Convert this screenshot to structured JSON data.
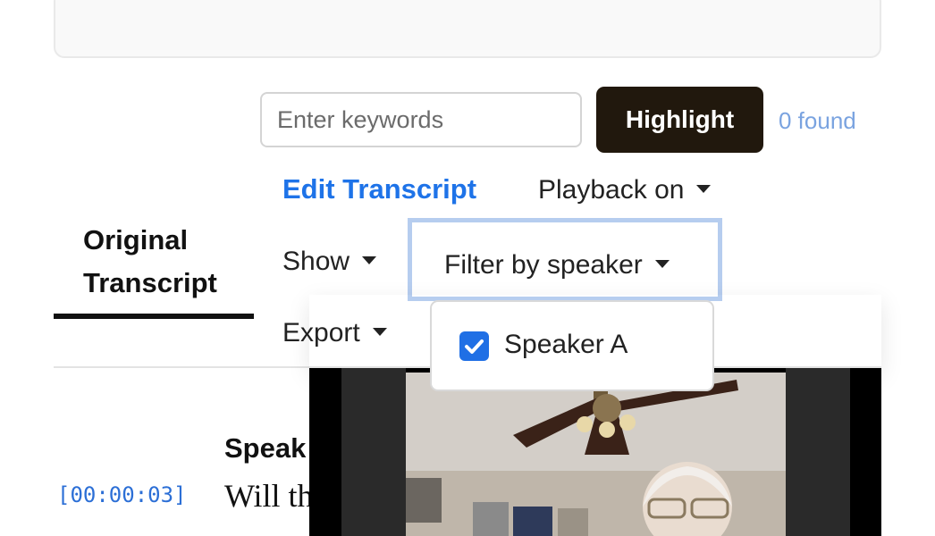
{
  "search": {
    "placeholder": "Enter keywords",
    "value": ""
  },
  "highlight_button": "Highlight",
  "found_count": "0 found",
  "edit_transcript": "Edit Transcript",
  "dropdowns": {
    "playback": "Playback on",
    "show": "Show",
    "filter": "Filter by speaker",
    "export": "Export"
  },
  "tab": {
    "label_line1": "Original",
    "label_line2": "Transcript"
  },
  "filter_menu": {
    "items": [
      {
        "label": "Speaker A",
        "checked": true
      }
    ]
  },
  "transcript": {
    "timestamp": "[00:00:03]",
    "speaker": "Speak",
    "text": "Will th"
  },
  "colors": {
    "accent": "#1e73e8",
    "button_dark": "#21180d",
    "checkbox": "#1f6fe5",
    "found": "#7aa3e0"
  }
}
